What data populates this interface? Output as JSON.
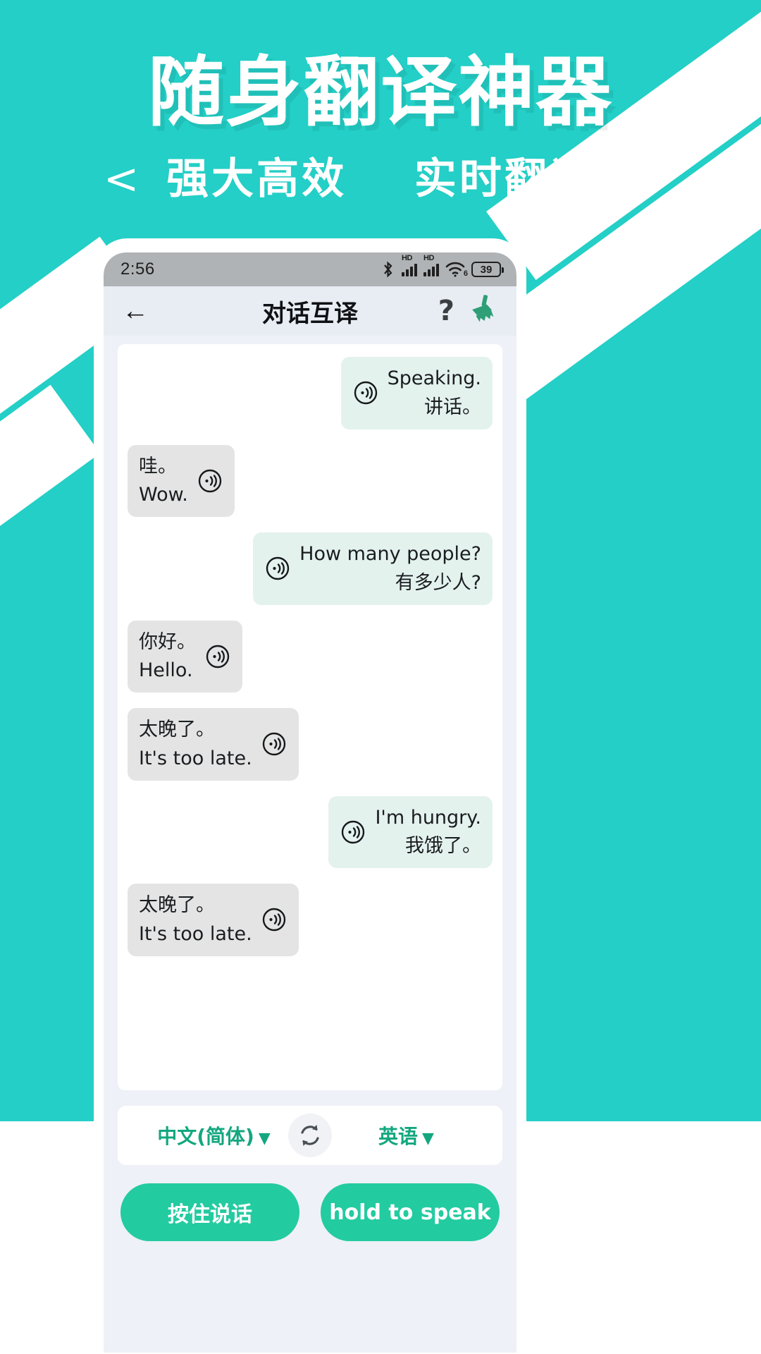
{
  "poster": {
    "title": "随身翻译神器",
    "subtitle_left_chevron": "<",
    "subtitle_a": "强大高效",
    "subtitle_b": "实时翻译",
    "subtitle_right_chevron": ">",
    "brand_color": "#23cfc6"
  },
  "status_bar": {
    "time": "2:56",
    "bluetooth_icon": "bluetooth-icon",
    "signal1_label": "HD",
    "signal2_label": "HD",
    "wifi_icon": "wifi-icon",
    "wifi_generation": "6",
    "battery_level": "39"
  },
  "app_bar": {
    "back_icon": "back-arrow-icon",
    "title": "对话互译",
    "help_label": "?",
    "clear_icon": "broom-icon",
    "accent_color": "#2e9e76"
  },
  "chat": [
    {
      "side": "right",
      "primary": "Speaking.",
      "secondary": "讲话。",
      "speaker_icon": "speaker-icon"
    },
    {
      "side": "left",
      "primary": "哇。",
      "secondary": "Wow.",
      "speaker_icon": "speaker-icon"
    },
    {
      "side": "right",
      "primary": "How many people?",
      "secondary": "有多少人?",
      "speaker_icon": "speaker-icon"
    },
    {
      "side": "left",
      "primary": "你好。",
      "secondary": "Hello.",
      "speaker_icon": "speaker-icon"
    },
    {
      "side": "left",
      "primary": "太晚了。",
      "secondary": "It's too late.",
      "speaker_icon": "speaker-icon"
    },
    {
      "side": "right",
      "primary": "I'm hungry.",
      "secondary": "我饿了。",
      "speaker_icon": "speaker-icon"
    },
    {
      "side": "left",
      "primary": "太晚了。",
      "secondary": "It's too late.",
      "speaker_icon": "speaker-icon"
    }
  ],
  "controls": {
    "source_language": "中文(简体)",
    "target_language": "英语",
    "caret": "▼",
    "swap_icon": "swap-languages-icon",
    "hold_to_speak_cn": "按住说话",
    "hold_to_speak_en": "hold to speak",
    "button_color": "#23cba0",
    "language_text_color": "#13a77f"
  }
}
